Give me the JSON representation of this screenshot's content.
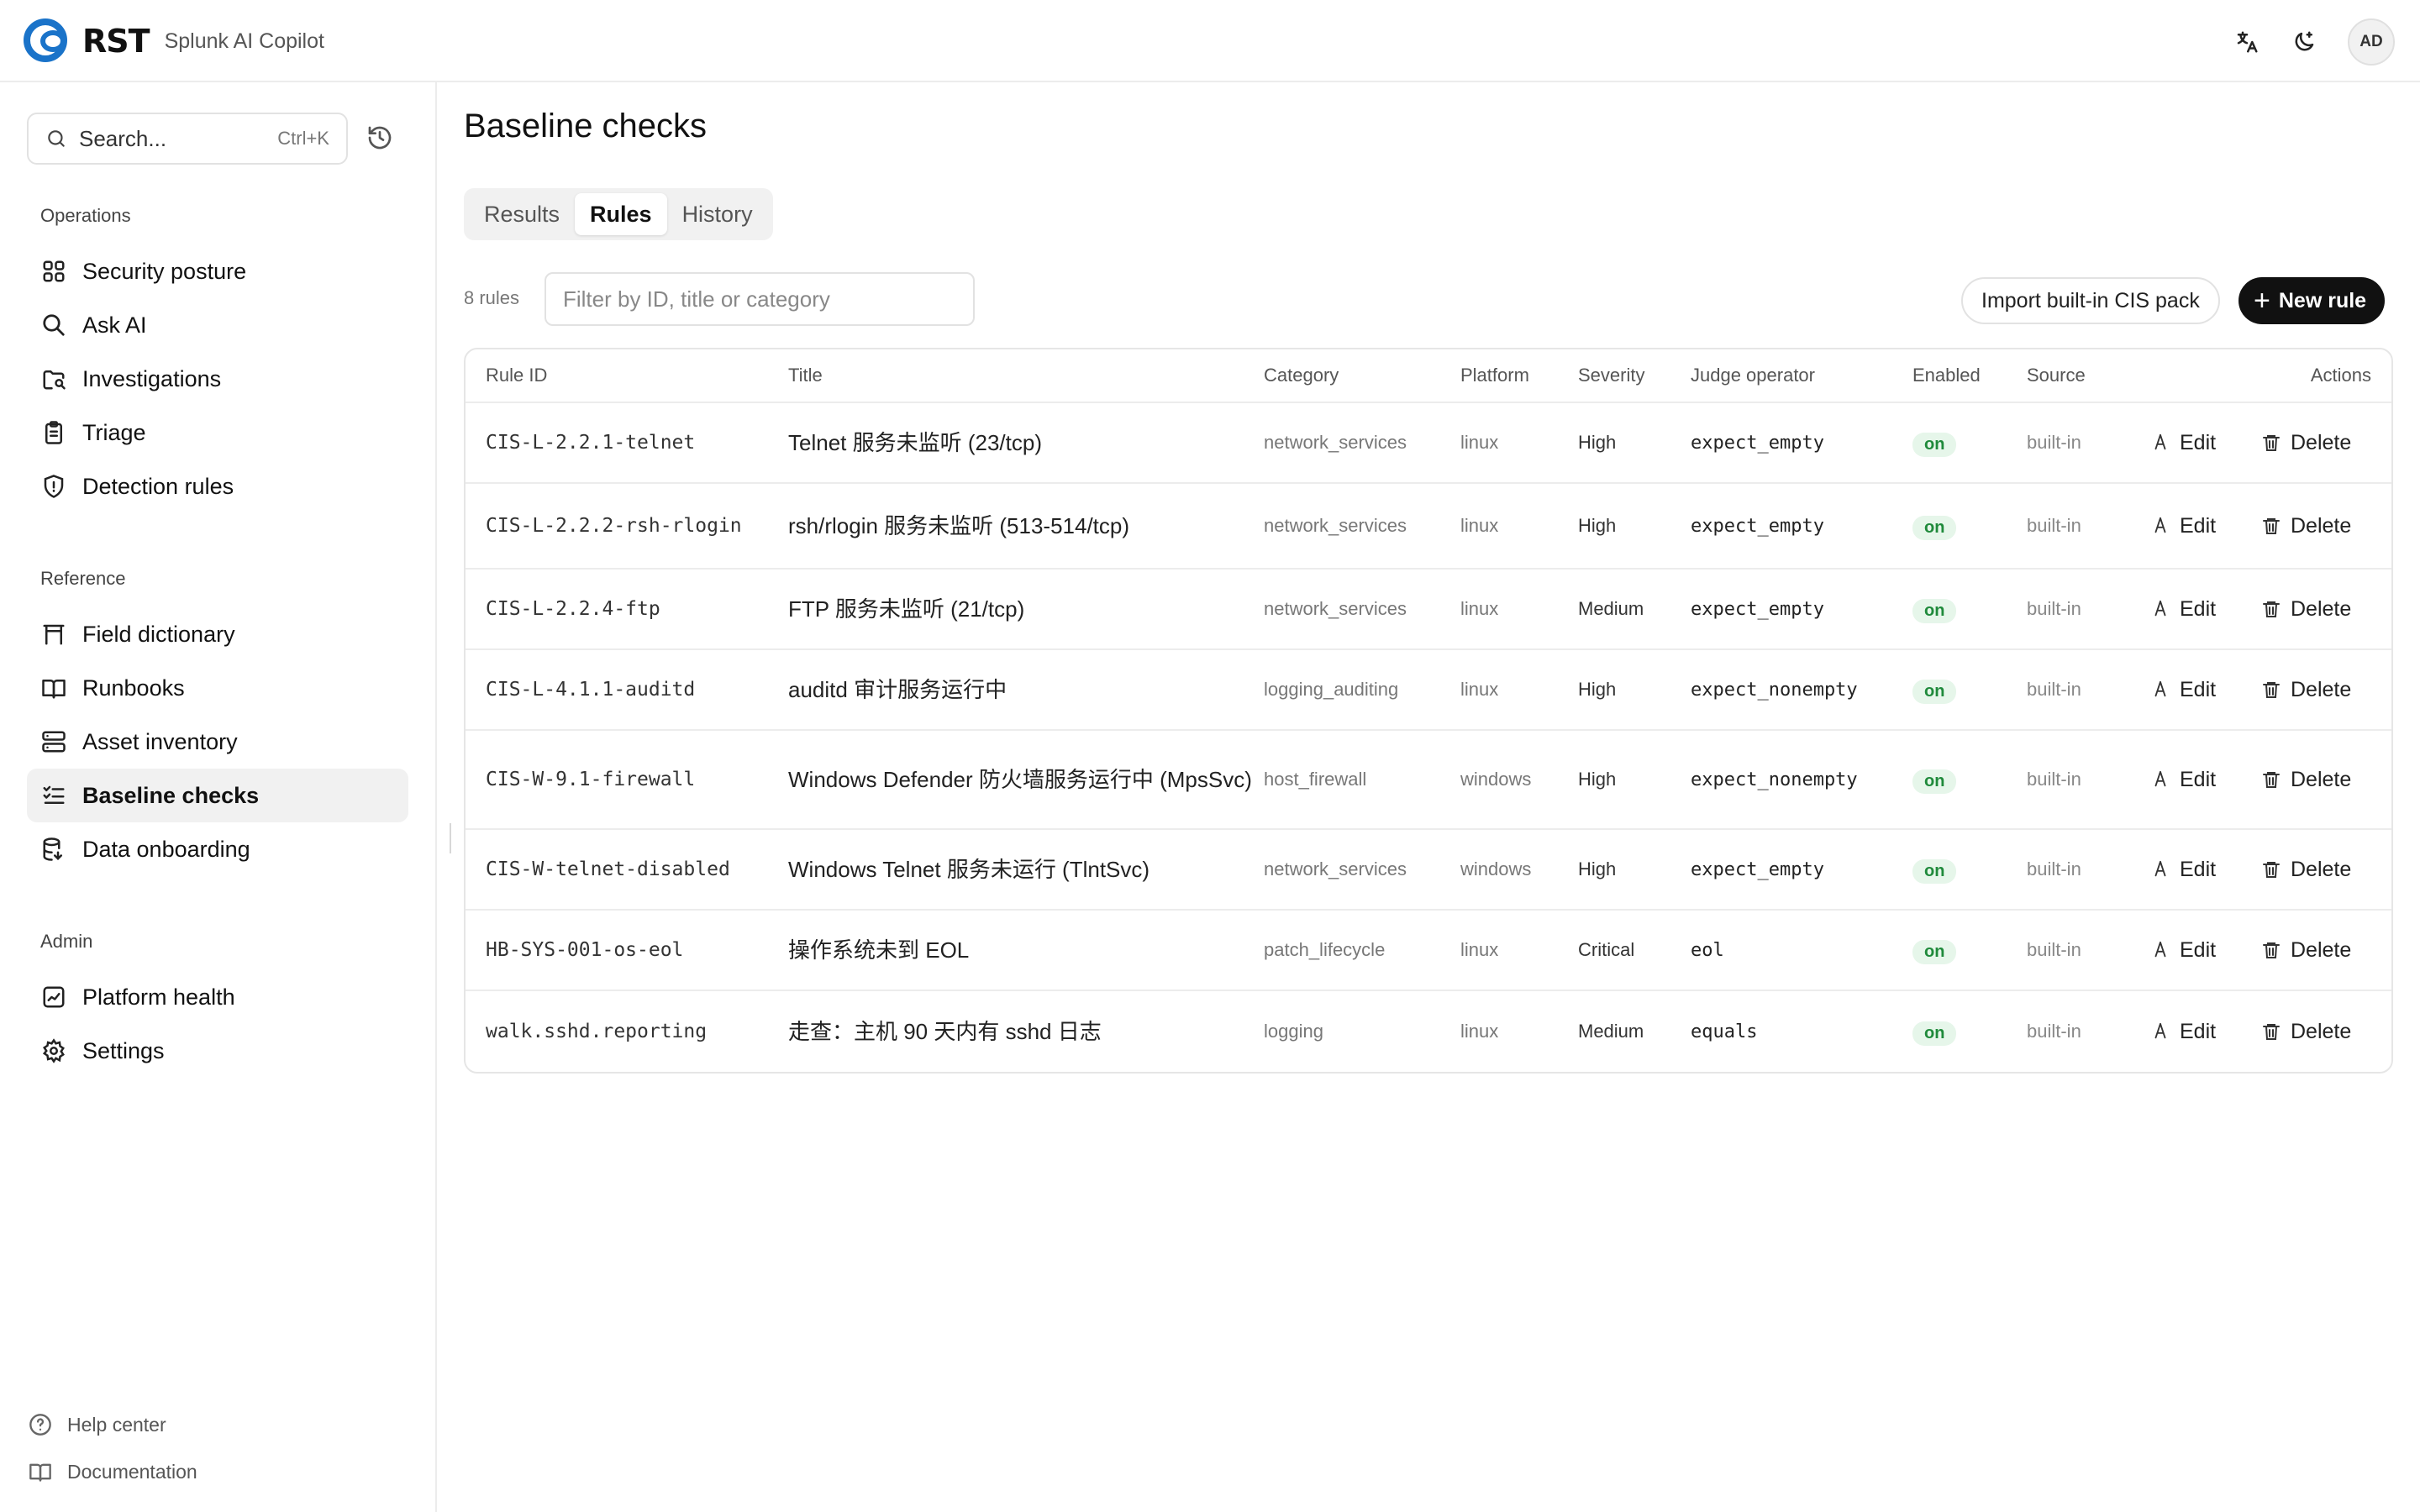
{
  "app": {
    "logo_text": "RST",
    "product_name": "Splunk AI Copilot",
    "avatar_initials": "AD",
    "header_icons": [
      "translate-icon",
      "theme-moon-icon"
    ]
  },
  "sidebar": {
    "search_label": "Search...",
    "search_shortcut": "Ctrl+K",
    "sections": [
      {
        "title": "Operations",
        "items": [
          {
            "label": "Security posture",
            "icon": "grid-icon"
          },
          {
            "label": "Ask AI",
            "icon": "search-icon"
          },
          {
            "label": "Investigations",
            "icon": "investigation-icon"
          },
          {
            "label": "Triage",
            "icon": "clipboard-icon"
          },
          {
            "label": "Detection rules",
            "icon": "shield-icon"
          }
        ]
      },
      {
        "title": "Reference",
        "items": [
          {
            "label": "Field dictionary",
            "icon": "table-icon"
          },
          {
            "label": "Runbooks",
            "icon": "book-icon"
          },
          {
            "label": "Asset inventory",
            "icon": "server-icon"
          },
          {
            "label": "Baseline checks",
            "icon": "checklist-icon",
            "active": true
          },
          {
            "label": "Data onboarding",
            "icon": "database-icon"
          }
        ]
      },
      {
        "title": "Admin",
        "items": [
          {
            "label": "Platform health",
            "icon": "chart-icon"
          },
          {
            "label": "Settings",
            "icon": "gear-icon"
          }
        ]
      }
    ],
    "footer": [
      {
        "label": "Help center",
        "icon": "help-icon"
      },
      {
        "label": "Documentation",
        "icon": "book-open-icon"
      }
    ]
  },
  "main": {
    "title": "Baseline checks",
    "tabs": [
      {
        "label": "Results"
      },
      {
        "label": "Rules",
        "active": true
      },
      {
        "label": "History"
      }
    ],
    "rule_count": "8 rules",
    "filter_placeholder": "Filter by ID, title or category",
    "import_button": "Import built-in CIS pack",
    "new_button": "New rule",
    "columns": [
      "Rule ID",
      "Title",
      "Category",
      "Platform",
      "Severity",
      "Judge operator",
      "Enabled",
      "Source",
      "Actions"
    ],
    "edit_label": "Edit",
    "delete_label": "Delete",
    "rows": [
      {
        "id": "CIS-L-2.2.1-telnet",
        "title": "Telnet 服务未监听 (23/tcp)",
        "category": "network_services",
        "platform": "linux",
        "severity": "High",
        "judge": "expect_empty",
        "enabled": "on",
        "source": "built-in"
      },
      {
        "id": "CIS-L-2.2.2-rsh-rlogin",
        "title": "rsh/rlogin 服务未监听 (513-514/tcp)",
        "category": "network_services",
        "platform": "linux",
        "severity": "High",
        "judge": "expect_empty",
        "enabled": "on",
        "source": "built-in"
      },
      {
        "id": "CIS-L-2.2.4-ftp",
        "title": "FTP 服务未监听 (21/tcp)",
        "category": "network_services",
        "platform": "linux",
        "severity": "Medium",
        "judge": "expect_empty",
        "enabled": "on",
        "source": "built-in"
      },
      {
        "id": "CIS-L-4.1.1-auditd",
        "title": "auditd 审计服务运行中",
        "category": "logging_auditing",
        "platform": "linux",
        "severity": "High",
        "judge": "expect_nonempty",
        "enabled": "on",
        "source": "built-in"
      },
      {
        "id": "CIS-W-9.1-firewall",
        "title": "Windows Defender 防火墙服务运行中 (MpsSvc)",
        "category": "host_firewall",
        "platform": "windows",
        "severity": "High",
        "judge": "expect_nonempty",
        "enabled": "on",
        "source": "built-in"
      },
      {
        "id": "CIS-W-telnet-disabled",
        "title": "Windows Telnet 服务未运行 (TlntSvc)",
        "category": "network_services",
        "platform": "windows",
        "severity": "High",
        "judge": "expect_empty",
        "enabled": "on",
        "source": "built-in"
      },
      {
        "id": "HB-SYS-001-os-eol",
        "title": "操作系统未到 EOL",
        "category": "patch_lifecycle",
        "platform": "linux",
        "severity": "Critical",
        "judge": "eol",
        "enabled": "on",
        "source": "built-in"
      },
      {
        "id": "walk.sshd.reporting",
        "title": "走查：主机 90 天内有 sshd 日志",
        "category": "logging",
        "platform": "linux",
        "severity": "Medium",
        "judge": "equals",
        "enabled": "on",
        "source": "built-in"
      }
    ]
  }
}
